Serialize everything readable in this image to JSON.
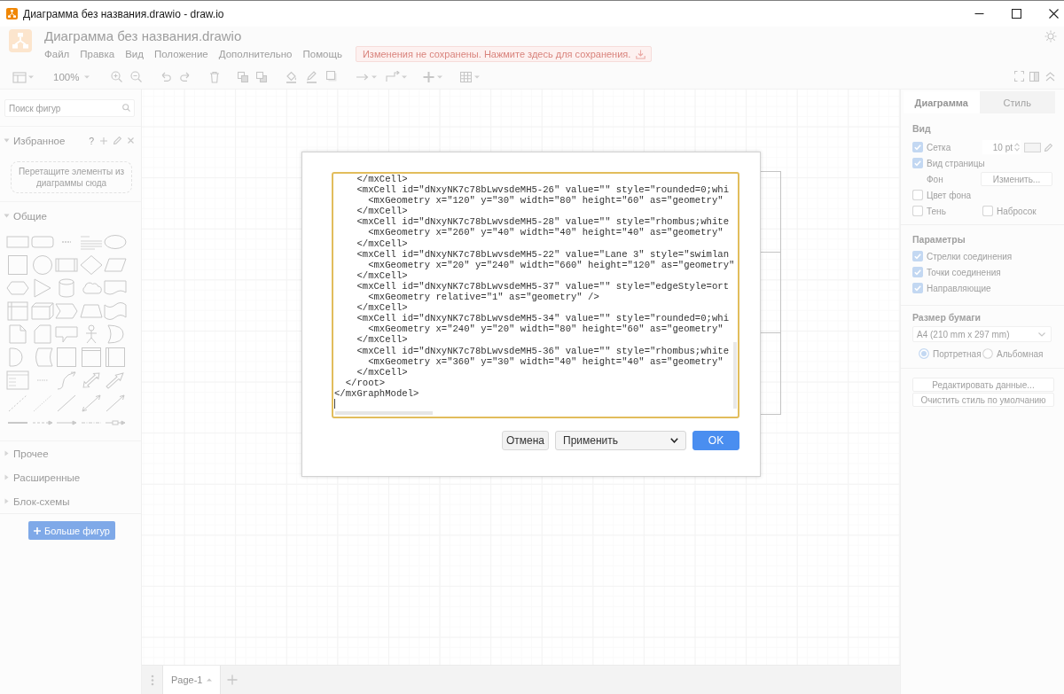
{
  "window": {
    "title": "Диаграмма без названия.drawio - draw.io"
  },
  "header": {
    "document_title": "Диаграмма без названия.drawio",
    "menu": [
      "Файл",
      "Правка",
      "Вид",
      "Положение",
      "Дополнительно",
      "Помощь"
    ],
    "unsaved_notice": "Изменения не сохранены. Нажмите здесь для сохранения."
  },
  "toolbar": {
    "zoom": "100%"
  },
  "sidebar": {
    "search": {
      "placeholder": "Поиск фигур"
    },
    "sections": [
      {
        "title": "Избранное",
        "kind": "favorites",
        "expanded": true,
        "help": "?",
        "hint": "Перетащите элементы из диаграммы сюда"
      },
      {
        "title": "Общие",
        "kind": "library",
        "expanded": true
      },
      {
        "title": "Прочее",
        "kind": "library",
        "expanded": false
      },
      {
        "title": "Расширенные",
        "kind": "library",
        "expanded": false
      },
      {
        "title": "Блок-схемы",
        "kind": "library",
        "expanded": false
      }
    ],
    "more_shapes_button": "Больше фигур"
  },
  "format_panel": {
    "tabs": [
      {
        "label": "Диаграмма",
        "selected": true
      },
      {
        "label": "Стиль",
        "selected": false
      }
    ],
    "view": {
      "title": "Вид",
      "grid": {
        "label": "Сетка",
        "checked": true,
        "size": "10 pt"
      },
      "page_view": {
        "label": "Вид страницы",
        "checked": true
      },
      "background": {
        "label": "Фон",
        "button": "Изменить..."
      },
      "background_color": {
        "label": "Цвет фона",
        "checked": false
      },
      "shadow": {
        "label": "Тень",
        "checked": false
      },
      "sketch": {
        "label": "Набросок",
        "checked": false
      }
    },
    "options": {
      "title": "Параметры",
      "items": [
        {
          "label": "Стрелки соединения",
          "checked": true
        },
        {
          "label": "Точки соединения",
          "checked": true
        },
        {
          "label": "Направляющие",
          "checked": true
        }
      ]
    },
    "paper_size": {
      "title": "Размер бумаги",
      "value": "A4 (210 mm x 297 mm)",
      "orientations": [
        {
          "label": "Портретная",
          "selected": true
        },
        {
          "label": "Альбомная",
          "selected": false
        }
      ]
    },
    "buttons": [
      "Редактировать данные...",
      "Очистить стиль по умолчанию"
    ]
  },
  "page_bar": {
    "pages": [
      {
        "label": "Page-1",
        "selected": true
      }
    ]
  },
  "dialog": {
    "xml_lines": [
      "    </mxCell>",
      "    <mxCell id=\"dNxyNK7c78bLwvsdeMH5-26\" value=\"\" style=\"rounded=0;whi",
      "      <mxGeometry x=\"120\" y=\"30\" width=\"80\" height=\"60\" as=\"geometry\"",
      "    </mxCell>",
      "    <mxCell id=\"dNxyNK7c78bLwvsdeMH5-28\" value=\"\" style=\"rhombus;white",
      "      <mxGeometry x=\"260\" y=\"40\" width=\"40\" height=\"40\" as=\"geometry\"",
      "    </mxCell>",
      "    <mxCell id=\"dNxyNK7c78bLwvsdeMH5-22\" value=\"Lane 3\" style=\"swimlan",
      "      <mxGeometry x=\"20\" y=\"240\" width=\"660\" height=\"120\" as=\"geometry\"",
      "    </mxCell>",
      "    <mxCell id=\"dNxyNK7c78bLwvsdeMH5-37\" value=\"\" style=\"edgeStyle=ort",
      "      <mxGeometry relative=\"1\" as=\"geometry\" />",
      "    </mxCell>",
      "    <mxCell id=\"dNxyNK7c78bLwvsdeMH5-34\" value=\"\" style=\"rounded=0;whi",
      "      <mxGeometry x=\"240\" y=\"20\" width=\"80\" height=\"60\" as=\"geometry\"",
      "    </mxCell>",
      "    <mxCell id=\"dNxyNK7c78bLwvsdeMH5-36\" value=\"\" style=\"rhombus;white",
      "      <mxGeometry x=\"360\" y=\"30\" width=\"40\" height=\"40\" as=\"geometry\"",
      "    </mxCell>",
      "  </root>",
      "</mxGraphModel>"
    ],
    "cancel_button": "Отмена",
    "action_select": "Применить",
    "ok_button": "OK"
  }
}
